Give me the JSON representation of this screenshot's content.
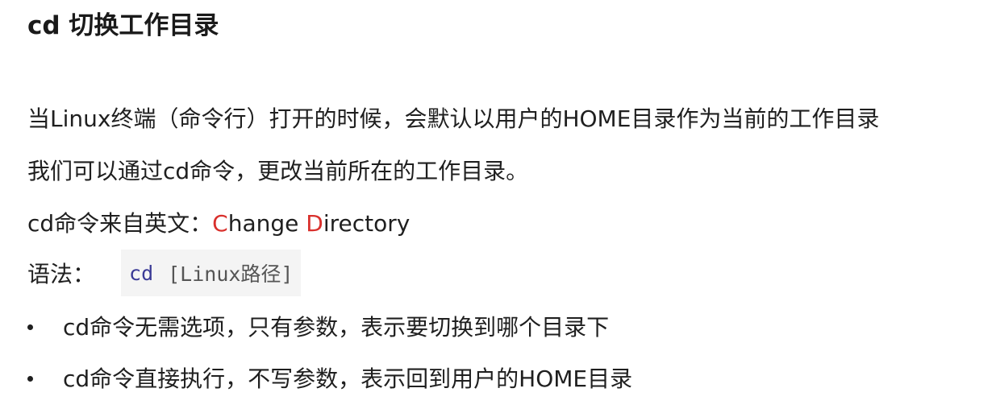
{
  "title": "cd 切换工作目录",
  "paragraphs": {
    "p1": "当Linux终端（命令行）打开的时候，会默认以用户的HOME目录作为当前的工作目录",
    "p2": "我们可以通过cd命令，更改当前所在的工作目录。",
    "p3": {
      "prefix": "cd命令来自英文：",
      "c_letter": "C",
      "c_rest": "hange ",
      "d_letter": "D",
      "d_rest": "irectory"
    }
  },
  "syntax": {
    "label": "语法：",
    "code_keyword": "cd",
    "code_arg": "[Linux路径]"
  },
  "bullets": [
    "cd命令无需选项，只有参数，表示要切换到哪个目录下",
    "cd命令直接执行，不写参数，表示回到用户的HOME目录"
  ],
  "colors": {
    "accent": "#d9302c",
    "code_keyword": "#3a3a96",
    "code_background": "#f4f4f4"
  }
}
